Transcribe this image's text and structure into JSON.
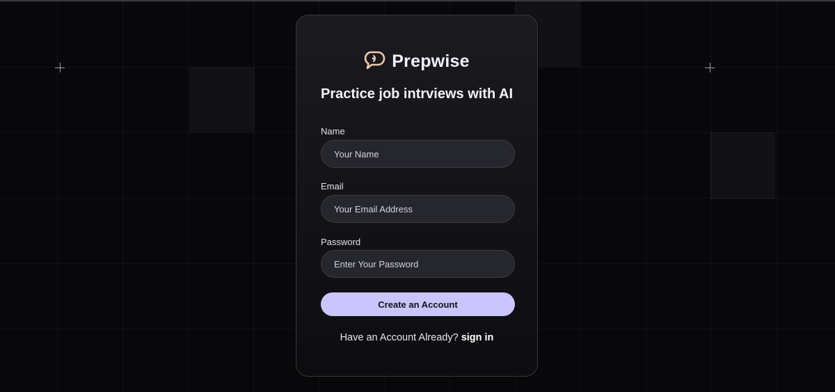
{
  "app": {
    "name": "Prepwise",
    "logo_icon": "chat-bubble-icon",
    "brand_colors": {
      "logo_accent": "#f2c9a5",
      "button": "#cac5fe"
    }
  },
  "form": {
    "headline": "Practice job intrviews with AI",
    "fields": [
      {
        "label": "Name",
        "placeholder": "Your Name",
        "value": ""
      },
      {
        "label": "Email",
        "placeholder": "Your Email Address",
        "value": ""
      },
      {
        "label": "Password",
        "placeholder": "Enter Your Password",
        "value": ""
      }
    ],
    "submit_label": "Create an Account",
    "footer_text": "Have an Account Already?",
    "footer_link": "sign in"
  }
}
